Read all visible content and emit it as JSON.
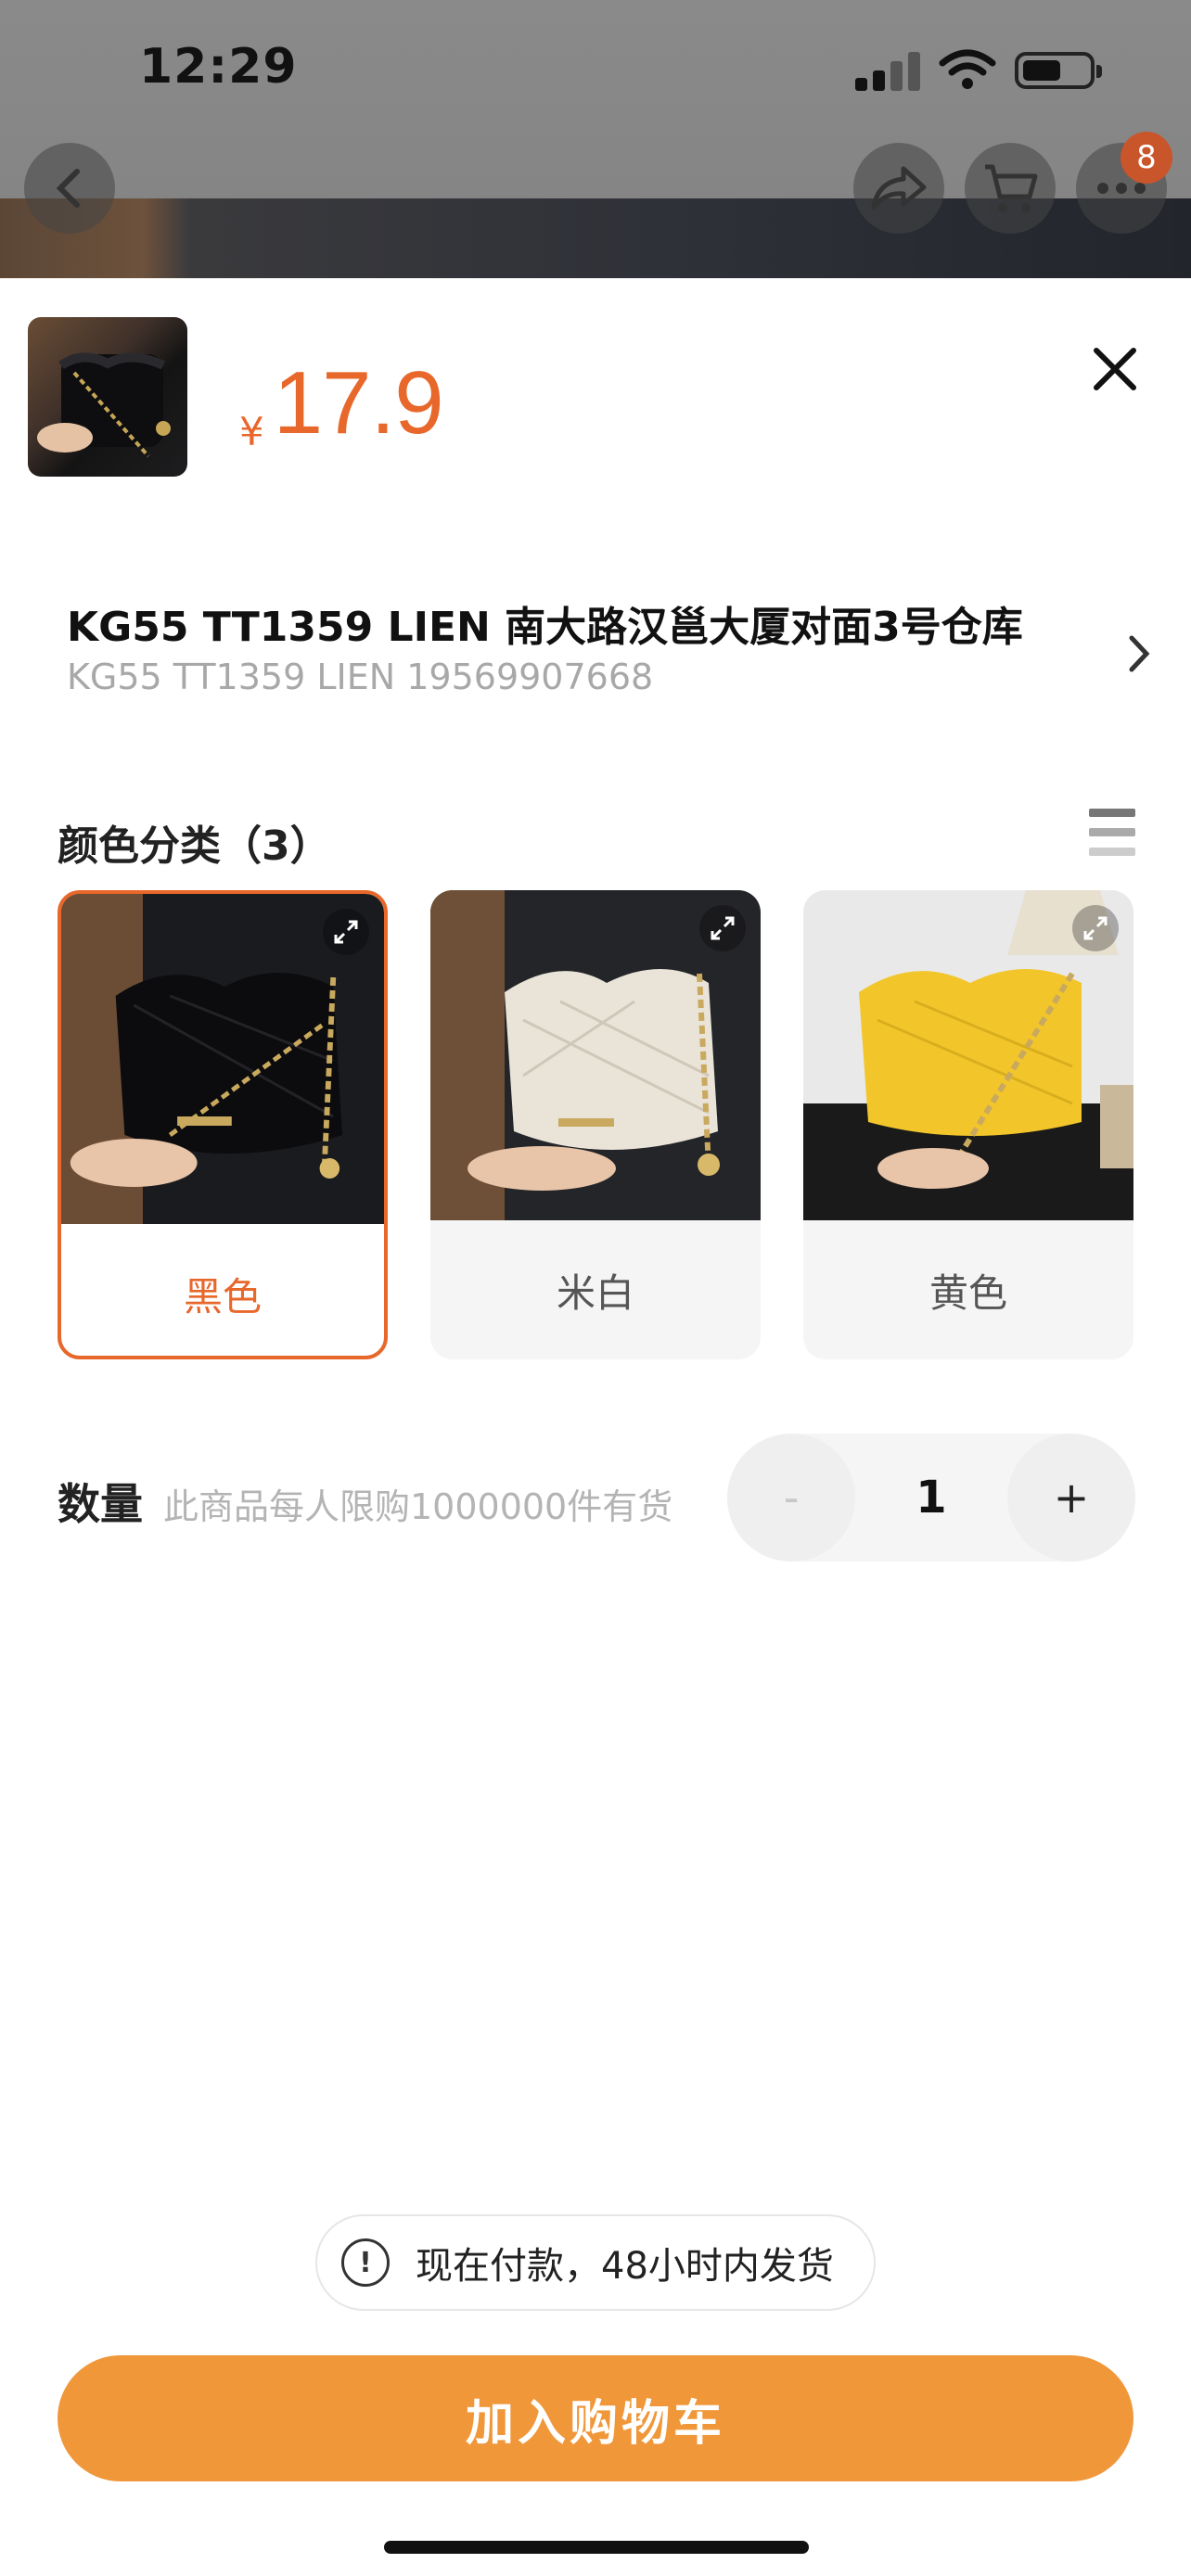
{
  "status_bar": {
    "time": "12:29"
  },
  "top_nav": {
    "cart_badge": "8"
  },
  "product": {
    "currency": "¥",
    "price": "17.9",
    "shop_name": "KG55 TT1359 LIEN  南大路汉邕大厦对面3号仓库",
    "shop_sub": "KG55 TT1359 LIEN 19569907668"
  },
  "variants": {
    "title": "颜色分类（3）",
    "options": [
      {
        "label": "黑色",
        "selected": true
      },
      {
        "label": "米白",
        "selected": false
      },
      {
        "label": "黄色",
        "selected": false
      }
    ]
  },
  "quantity": {
    "label": "数量",
    "note": "此商品每人限购1000000件有货",
    "minus": "-",
    "value": "1",
    "plus": "+"
  },
  "notice": {
    "icon": "!",
    "text": "现在付款，48小时内发货"
  },
  "cta": {
    "label": "加入购物车"
  },
  "colors": {
    "accent": "#e8672a",
    "cta": "#f0973a"
  }
}
